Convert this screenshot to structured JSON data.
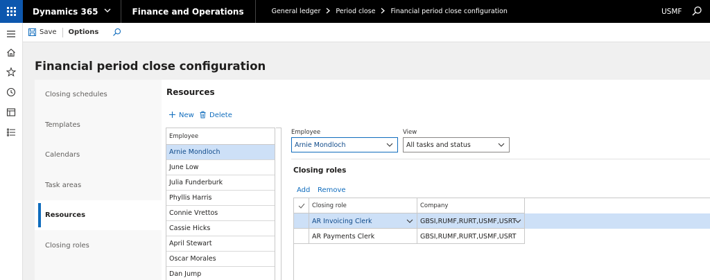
{
  "topbar": {
    "brand": "Dynamics 365",
    "app_name": "Finance and Operations",
    "breadcrumb": [
      "General ledger",
      "Period close",
      "Financial period close configuration"
    ],
    "company": "USMF"
  },
  "actions": {
    "save_label": "Save",
    "options_label": "Options"
  },
  "page": {
    "title": "Financial period close configuration"
  },
  "tabs": [
    {
      "label": "Closing schedules",
      "active": false
    },
    {
      "label": "Templates",
      "active": false
    },
    {
      "label": "Calendars",
      "active": false
    },
    {
      "label": "Task areas",
      "active": false
    },
    {
      "label": "Resources",
      "active": true
    },
    {
      "label": "Closing roles",
      "active": false
    }
  ],
  "resources": {
    "title": "Resources",
    "new_label": "New",
    "delete_label": "Delete",
    "list_header": "Employee",
    "employees": [
      "Arnie Mondloch",
      "June Low",
      "Julia Funderburk",
      "Phyllis Harris",
      "Connie Vrettos",
      "Cassie Hicks",
      "April Stewart",
      "Oscar Morales",
      "Dan Jump"
    ],
    "selected_index": 0
  },
  "details": {
    "employee_label": "Employee",
    "employee_value": "Arnie Mondloch",
    "view_label": "View",
    "view_value": "All tasks and status"
  },
  "closing_roles": {
    "title": "Closing roles",
    "add_label": "Add",
    "remove_label": "Remove",
    "columns": [
      "Closing role",
      "Company"
    ],
    "rows": [
      {
        "role": "AR Invoicing Clerk",
        "company": "GBSI,RUMF,RURT,USMF,USRT",
        "selected": true
      },
      {
        "role": "AR Payments Clerk",
        "company": "GBSI,RUMF,RURT,USMF,USRT",
        "selected": false
      }
    ]
  },
  "colors": {
    "accent": "#0f6cbd",
    "waffle": "#0d57ae",
    "selection": "#cde0f7"
  }
}
